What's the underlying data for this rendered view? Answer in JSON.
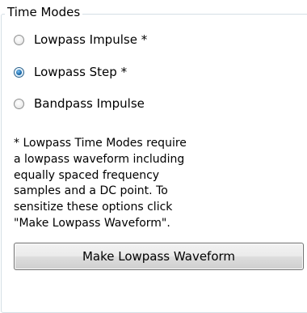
{
  "group": {
    "title": "Time Modes"
  },
  "options": [
    {
      "label": "Lowpass Impulse *",
      "selected": false
    },
    {
      "label": "Lowpass Step *",
      "selected": true
    },
    {
      "label": "Bandpass Impulse",
      "selected": false
    }
  ],
  "note": "* Lowpass Time Modes require\na lowpass waveform including\nequally spaced frequency\nsamples and a DC point. To\nsensitize these options click\n\"Make Lowpass Waveform\".",
  "button": {
    "label": "Make Lowpass Waveform"
  }
}
